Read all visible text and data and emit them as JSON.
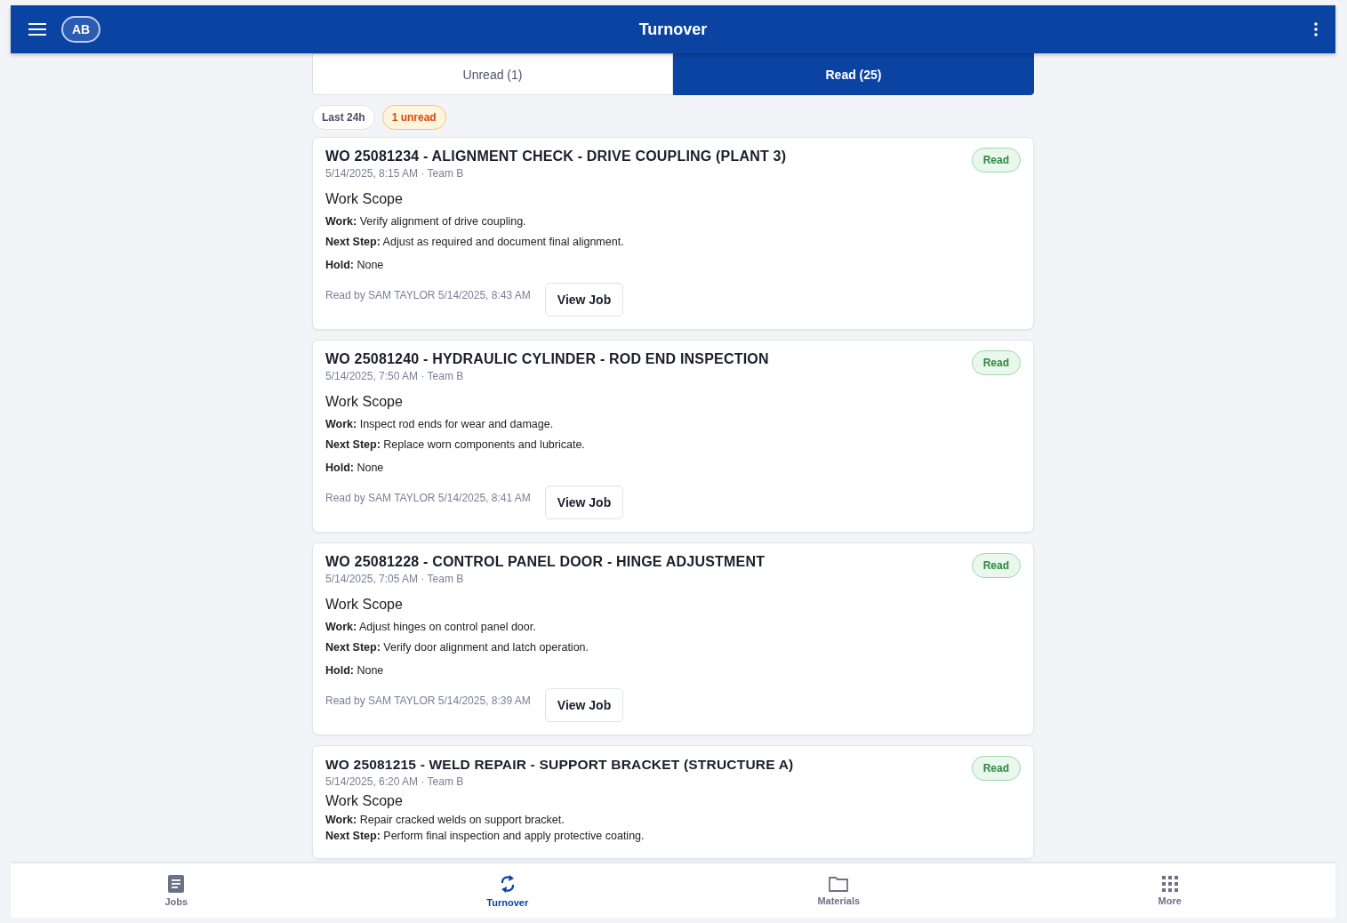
{
  "header": {
    "avatar": "AB",
    "title": "Turnover"
  },
  "tabs": [
    {
      "label": "Unread (1)",
      "selected": false
    },
    {
      "label": "Read (25)",
      "selected": true
    }
  ],
  "chips": [
    {
      "label": "Last 24h",
      "kind": "plain"
    },
    {
      "label": "1 unread",
      "kind": "warning"
    }
  ],
  "cards": [
    {
      "title": "WO 25081234 - ALIGNMENT CHECK - DRIVE COUPLING (PLANT 3)",
      "meta": "5/14/2025, 8:15 AM · Team B",
      "status": "Read",
      "section": "Work Scope",
      "fields": [
        {
          "label": "Work:",
          "value": "Verify alignment of drive coupling."
        },
        {
          "label": "Next Step:",
          "value": "Adjust as required and document final alignment."
        },
        {
          "label": "Hold:",
          "value": "None"
        }
      ],
      "read_by": "Read by SAM TAYLOR 5/14/2025, 8:43 AM",
      "action": "View Job"
    },
    {
      "title": "WO 25081240 - HYDRAULIC CYLINDER - ROD END INSPECTION",
      "meta": "5/14/2025, 7:50 AM · Team B",
      "status": "Read",
      "section": "Work Scope",
      "fields": [
        {
          "label": "Work:",
          "value": "Inspect rod ends for wear and damage."
        },
        {
          "label": "Next Step:",
          "value": "Replace worn components and lubricate."
        },
        {
          "label": "Hold:",
          "value": "None"
        }
      ],
      "read_by": "Read by SAM TAYLOR 5/14/2025, 8:41 AM",
      "action": "View Job"
    },
    {
      "title": "WO 25081228 - CONTROL PANEL DOOR - HINGE ADJUSTMENT",
      "meta": "5/14/2025, 7:05 AM · Team B",
      "status": "Read",
      "section": "Work Scope",
      "fields": [
        {
          "label": "Work:",
          "value": "Adjust hinges on control panel door."
        },
        {
          "label": "Next Step:",
          "value": "Verify door alignment and latch operation."
        },
        {
          "label": "Hold:",
          "value": "None"
        }
      ],
      "read_by": "Read by SAM TAYLOR 5/14/2025, 8:39 AM",
      "action": "View Job"
    },
    {
      "title": "WO 25081215 - WELD REPAIR - SUPPORT BRACKET (STRUCTURE A)",
      "meta": "5/14/2025, 6:20 AM · Team B",
      "status": "Read",
      "section": "Work Scope",
      "fields": [
        {
          "label": "Work:",
          "value": "Repair cracked welds on support bracket."
        },
        {
          "label": "Next Step:",
          "value": "Perform final inspection and apply protective coating."
        }
      ]
    }
  ],
  "nav": [
    {
      "label": "Jobs",
      "kind": "jobs",
      "selected": false
    },
    {
      "label": "Turnover",
      "kind": "turnover",
      "selected": true
    },
    {
      "label": "Materials",
      "kind": "materials",
      "selected": false
    },
    {
      "label": "More",
      "kind": "more",
      "selected": false
    }
  ]
}
